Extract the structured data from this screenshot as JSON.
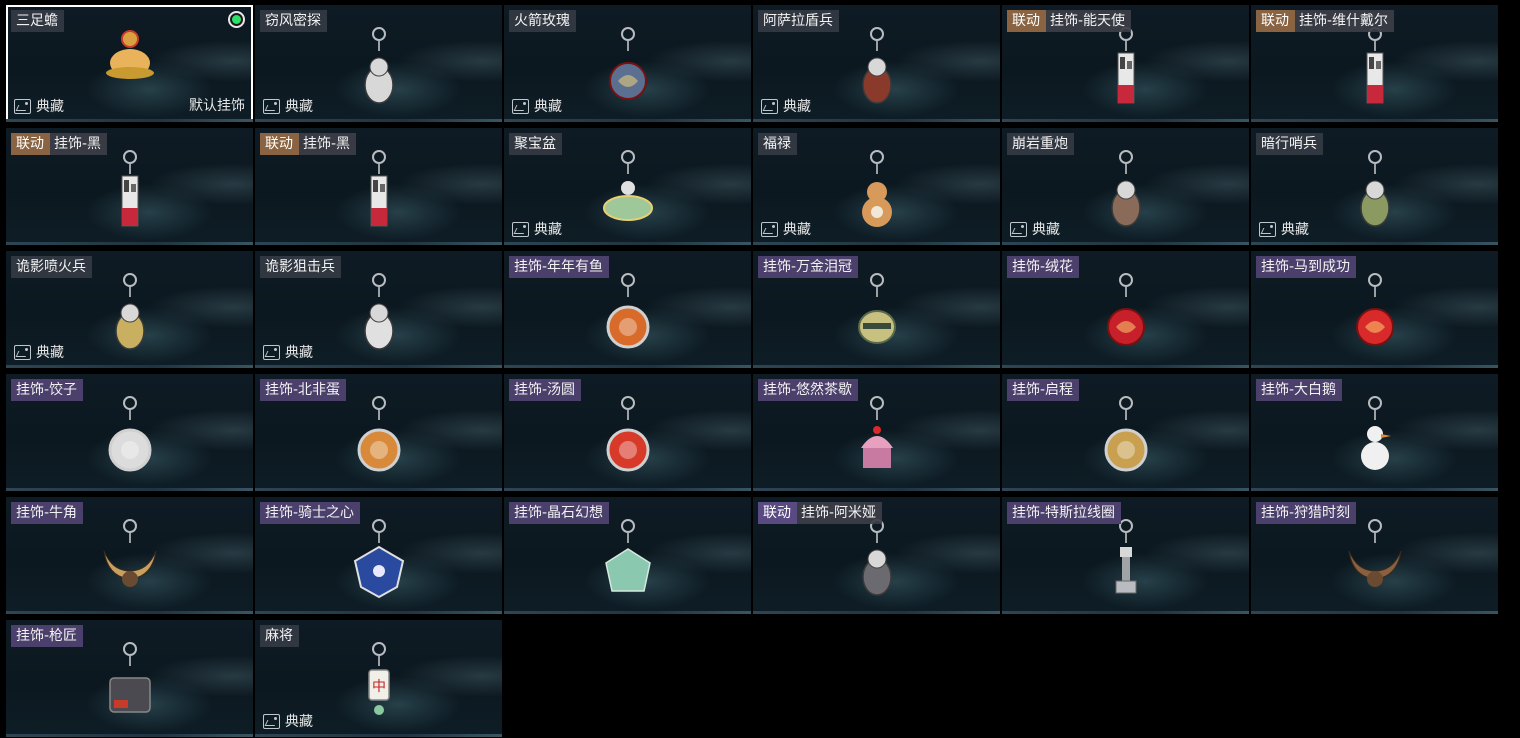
{
  "tag_label": "联动",
  "collection_label": "典藏",
  "default_label": "默认挂饰",
  "items": [
    {
      "name": "三足蟾",
      "tag": false,
      "collection": true,
      "default": true,
      "selected": true,
      "icon": "toad-charm-icon",
      "color": "#e8b35a"
    },
    {
      "name": "窃风密探",
      "tag": false,
      "collection": true,
      "icon": "rabbit-spy-charm-icon",
      "color": "#d8d8d8"
    },
    {
      "name": "火箭玫瑰",
      "tag": false,
      "collection": true,
      "icon": "rocket-rose-charm-icon",
      "color": "#5b7090"
    },
    {
      "name": "阿萨拉盾兵",
      "tag": false,
      "collection": true,
      "icon": "shield-soldier-charm-icon",
      "color": "#8a3a2a"
    },
    {
      "name": "挂饰-能天使",
      "tag": true,
      "collection": false,
      "icon": "exusiai-tag-charm-icon",
      "color": "#c8283c"
    },
    {
      "name": "挂饰-维什戴尔",
      "tag": true,
      "collection": false,
      "icon": "wisadel-tag-charm-icon",
      "color": "#c8283c"
    },
    {
      "name": "挂饰-黑",
      "tag": true,
      "collection": false,
      "icon": "black-tag-charm-icon",
      "color": "#c8283c"
    },
    {
      "name": "挂饰-黑",
      "tag": true,
      "collection": false,
      "icon": "black-tag-charm-icon",
      "color": "#c8283c"
    },
    {
      "name": "聚宝盆",
      "tag": false,
      "collection": true,
      "icon": "treasure-bowl-charm-icon",
      "color": "#9ec89a"
    },
    {
      "name": "福禄",
      "tag": false,
      "collection": true,
      "icon": "gourd-charm-icon",
      "color": "#d89a5a"
    },
    {
      "name": "崩岩重炮",
      "tag": false,
      "collection": true,
      "icon": "heavy-cannon-charm-icon",
      "color": "#8a6a58"
    },
    {
      "name": "暗行哨兵",
      "tag": false,
      "collection": true,
      "icon": "sentinel-charm-icon",
      "color": "#8a9a60"
    },
    {
      "name": "诡影喷火兵",
      "tag": false,
      "collection": true,
      "icon": "flamethrower-charm-icon",
      "color": "#c8b060"
    },
    {
      "name": "诡影狙击兵",
      "tag": false,
      "collection": true,
      "icon": "sniper-charm-icon",
      "color": "#e0e0e0"
    },
    {
      "name": "挂饰-年年有鱼",
      "tag": false,
      "collection": false,
      "purple": true,
      "icon": "fish-plate-charm-icon",
      "color": "#d86a2a"
    },
    {
      "name": "挂饰-万金泪冠",
      "tag": false,
      "collection": false,
      "purple": true,
      "icon": "crown-charm-icon",
      "color": "#c8c080"
    },
    {
      "name": "挂饰-绒花",
      "tag": false,
      "collection": false,
      "purple": true,
      "icon": "rose-charm-icon",
      "color": "#c8202a"
    },
    {
      "name": "挂饰-马到成功",
      "tag": false,
      "collection": false,
      "purple": true,
      "icon": "horse-charm-icon",
      "color": "#d82a2a"
    },
    {
      "name": "挂饰-饺子",
      "tag": false,
      "collection": false,
      "purple": true,
      "icon": "dumpling-charm-icon",
      "color": "#dcdcdc"
    },
    {
      "name": "挂饰-北非蛋",
      "tag": false,
      "collection": false,
      "purple": true,
      "icon": "shakshuka-charm-icon",
      "color": "#d88a3a"
    },
    {
      "name": "挂饰-汤圆",
      "tag": false,
      "collection": false,
      "purple": true,
      "icon": "tangyuan-charm-icon",
      "color": "#d83a2a"
    },
    {
      "name": "挂饰-悠然茶歇",
      "tag": false,
      "collection": false,
      "purple": true,
      "icon": "cupcake-charm-icon",
      "color": "#e8a0c0"
    },
    {
      "name": "挂饰-启程",
      "tag": false,
      "collection": false,
      "purple": true,
      "icon": "compass-charm-icon",
      "color": "#c8a050"
    },
    {
      "name": "挂饰-大白鹅",
      "tag": false,
      "collection": false,
      "purple": true,
      "icon": "goose-charm-icon",
      "color": "#f0f0f0"
    },
    {
      "name": "挂饰-牛角",
      "tag": false,
      "collection": false,
      "purple": true,
      "icon": "horns-charm-icon",
      "color": "#c8a060"
    },
    {
      "name": "挂饰-骑士之心",
      "tag": false,
      "collection": false,
      "purple": true,
      "icon": "knight-heart-charm-icon",
      "color": "#2a4aa0"
    },
    {
      "name": "挂饰-晶石幻想",
      "tag": false,
      "collection": false,
      "purple": true,
      "icon": "crystal-cube-charm-icon",
      "color": "#8ac8b0"
    },
    {
      "name": "挂饰-阿米娅",
      "tag": true,
      "collection": false,
      "purple_tag": true,
      "icon": "amiya-charm-icon",
      "color": "#6a6a70"
    },
    {
      "name": "挂饰-特斯拉线圈",
      "tag": false,
      "collection": false,
      "purple": true,
      "icon": "tesla-coil-charm-icon",
      "color": "#b8bcc0"
    },
    {
      "name": "挂饰-狩猎时刻",
      "tag": false,
      "collection": false,
      "purple": true,
      "icon": "antlers-charm-icon",
      "color": "#8a6040"
    },
    {
      "name": "挂饰-枪匠",
      "tag": false,
      "collection": false,
      "purple": true,
      "icon": "gunsmith-charm-icon",
      "color": "#4a4a50"
    },
    {
      "name": "麻将",
      "tag": false,
      "collection": true,
      "icon": "mahjong-charm-icon",
      "color": "#f0f0e8"
    }
  ]
}
